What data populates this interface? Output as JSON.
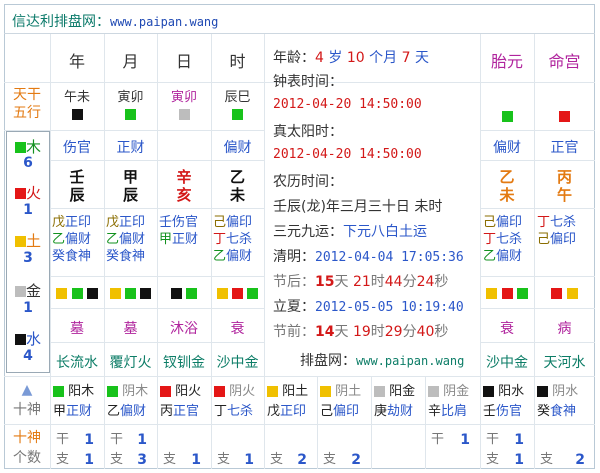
{
  "header": {
    "title": "信达利排盘网：",
    "url": "www.paipan.wang"
  },
  "columns": {
    "year": "年",
    "month": "月",
    "day": "日",
    "hour": "时",
    "taiyuan": "胎元",
    "minggong": "命宫"
  },
  "row_labels": {
    "tiangan": "天干",
    "wuxing": "五行",
    "shishen": "十神",
    "count": "个数"
  },
  "colors": {
    "green": "#18c21b",
    "red": "#e41616",
    "yellow": "#f0c000",
    "black": "#111111",
    "gray": "#bdbdbd"
  },
  "wuxing_counts": [
    {
      "name": "木",
      "count": "6",
      "color": "green"
    },
    {
      "name": "火",
      "count": "1",
      "color": "red"
    },
    {
      "name": "土",
      "count": "3",
      "color": "yellow"
    },
    {
      "name": "金",
      "count": "1",
      "color": "gray"
    },
    {
      "name": "水",
      "count": "4",
      "color": "black"
    }
  ],
  "pillars": [
    {
      "pair": "午未",
      "shishen": "伤官",
      "gan": "壬",
      "zhi": "辰",
      "cang": [
        [
          "戊",
          "正印"
        ],
        [
          "乙",
          "偏财"
        ],
        [
          "癸",
          "食神"
        ]
      ],
      "dishi": "墓",
      "nayin": "长流水"
    },
    {
      "pair": "寅卯",
      "shishen": "正财",
      "gan": "甲",
      "zhi": "辰",
      "cang": [
        [
          "戊",
          "正印"
        ],
        [
          "乙",
          "偏财"
        ],
        [
          "癸",
          "食神"
        ]
      ],
      "dishi": "墓",
      "nayin": "覆灯火"
    },
    {
      "pair": "寅卯",
      "shishen": "",
      "gan": "辛",
      "zhi": "亥",
      "cang": [
        [
          "壬",
          "伤官"
        ],
        [
          "甲",
          "正财"
        ]
      ],
      "dishi": "沐浴",
      "nayin": "钗钏金"
    },
    {
      "pair": "辰巳",
      "shishen": "偏财",
      "gan": "乙",
      "zhi": "未",
      "cang": [
        [
          "己",
          "偏印"
        ],
        [
          "丁",
          "七杀"
        ],
        [
          "乙",
          "偏财"
        ]
      ],
      "dishi": "衰",
      "nayin": "沙中金"
    }
  ],
  "taiyuan": {
    "shishen": "偏财",
    "gan": "乙",
    "zhi": "未",
    "cang": [
      [
        "己",
        "偏印"
      ],
      [
        "丁",
        "七杀"
      ],
      [
        "乙",
        "偏财"
      ]
    ],
    "dishi": "衰",
    "nayin": "沙中金"
  },
  "minggong": {
    "shishen": "正官",
    "gan": "丙",
    "zhi": "午",
    "cang": [
      [
        "丁",
        "七杀"
      ],
      [
        "己",
        "偏印"
      ]
    ],
    "dishi": "病",
    "nayin": "天河水"
  },
  "info": {
    "age_label": "年龄：",
    "age_years": "4",
    "years_unit": "岁",
    "age_months": "10",
    "months_unit": "个月",
    "age_days": "7",
    "days_unit": "天",
    "clock_label": "钟表时间：",
    "clock_time": "2012-04-20 14:50:00",
    "solar_label": "真太阳时：",
    "solar_time": "2012-04-20 14:50:00",
    "lunar_label": "农历时间：",
    "lunar_value": "壬辰(龙)年三月三十日 未时",
    "yun_label": "三元九运：",
    "yun_value": "下元八白土运",
    "qingming_label": "清明：",
    "qingming_time": "2012-04-04 17:05:36",
    "before_label": "节后：",
    "before_days": "15",
    "before_d_unit": "天",
    "before_h": "21",
    "before_h_unit": "时",
    "before_m": "44",
    "before_m_unit": "分",
    "before_s": "24",
    "before_s_unit": "秒",
    "lixia_label": "立夏：",
    "lixia_time": "2012-05-05 10:19:40",
    "after_label": "节前：",
    "after_days": "14",
    "after_d_unit": "天",
    "after_h": "19",
    "after_h_unit": "时",
    "after_m": "29",
    "after_m_unit": "分",
    "after_s": "40",
    "after_s_unit": "秒",
    "site_label": "排盘网：",
    "site_url": "www.paipan.wang"
  },
  "bottom_shishen": [
    {
      "el": "阳木",
      "color": "green",
      "gan": "甲",
      "name": "正财"
    },
    {
      "el": "阴木",
      "color": "green",
      "gan": "乙",
      "name": "偏财"
    },
    {
      "el": "阳火",
      "color": "red",
      "gan": "丙",
      "name": "正官"
    },
    {
      "el": "阴火",
      "color": "red",
      "gan": "丁",
      "name": "七杀"
    },
    {
      "el": "阳土",
      "color": "yellow",
      "gan": "戊",
      "name": "正印"
    },
    {
      "el": "阴土",
      "color": "yellow",
      "gan": "己",
      "name": "偏印"
    },
    {
      "el": "阳金",
      "color": "gray",
      "gan": "庚",
      "name": "劫财"
    },
    {
      "el": "阴金",
      "color": "gray",
      "gan": "辛",
      "name": "比肩"
    },
    {
      "el": "阳水",
      "color": "black",
      "gan": "壬",
      "name": "伤官"
    },
    {
      "el": "阴水",
      "color": "black",
      "gan": "癸",
      "name": "食神"
    }
  ],
  "bottom_counts": [
    {
      "gan": "1",
      "zhi": "1"
    },
    {
      "gan": "1",
      "zhi": "3"
    },
    {
      "gan": "",
      "zhi": "1"
    },
    {
      "gan": "",
      "zhi": "1"
    },
    {
      "gan": "",
      "zhi": "2"
    },
    {
      "gan": "",
      "zhi": "2"
    },
    {
      "gan": "",
      "zhi": ""
    },
    {
      "gan": "1",
      "zhi": ""
    },
    {
      "gan": "1",
      "zhi": "1"
    },
    {
      "gan": "",
      "zhi": "2"
    }
  ],
  "count_labels": {
    "gan": "干",
    "zhi": "支",
    "arrow": "▲"
  }
}
